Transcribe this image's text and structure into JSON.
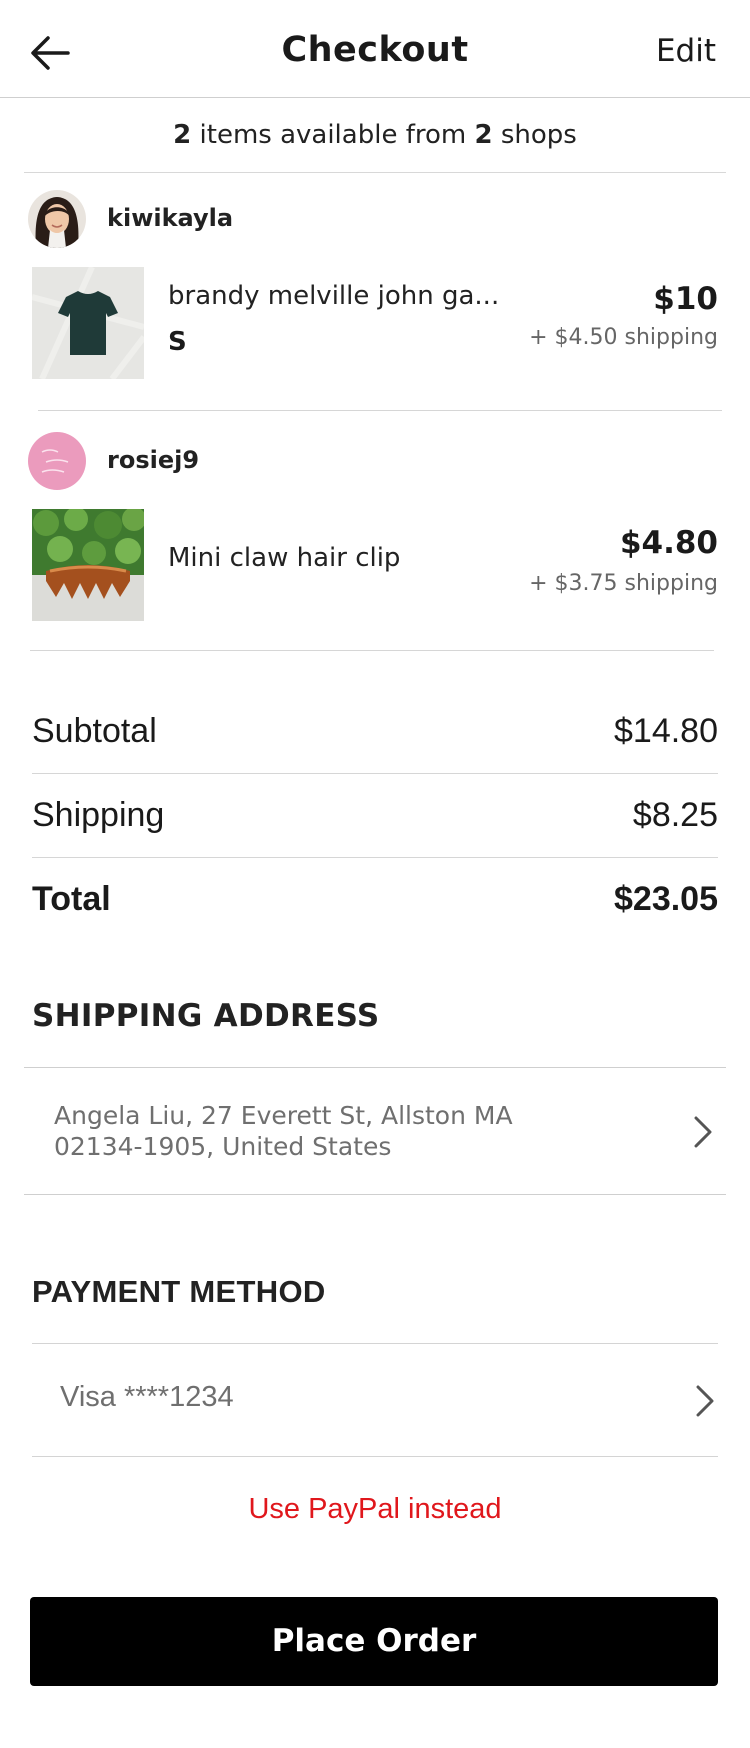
{
  "header": {
    "title": "Checkout",
    "edit_label": "Edit"
  },
  "summary": {
    "items_count": "2",
    "mid_text": "items available from",
    "shops_count": "2",
    "end_text": "shops"
  },
  "shops": [
    {
      "name": "kiwikayla",
      "item": {
        "title": "brandy melville john ga...",
        "size": "S",
        "price": "$10",
        "shipping": "+ $4.50 shipping"
      }
    },
    {
      "name": "rosiej9",
      "item": {
        "title": "Mini claw hair clip",
        "price": "$4.80",
        "shipping": "+ $3.75 shipping"
      }
    }
  ],
  "totals": {
    "subtotal_label": "Subtotal",
    "subtotal": "$14.80",
    "shipping_label": "Shipping",
    "shipping": "$8.25",
    "total_label": "Total",
    "total": "$23.05"
  },
  "shipping_address": {
    "title": "SHIPPING ADDRESS",
    "line1": "Angela Liu, 27 Everett St, Allston MA",
    "line2": "02134-1905, United States"
  },
  "payment": {
    "title": "PAYMENT METHOD",
    "card": "Visa ****1234",
    "paypal_label": "Use PayPal instead"
  },
  "actions": {
    "place_order_label": "Place Order"
  },
  "colors": {
    "accent_red": "#e0171c",
    "button_bg": "#000000"
  },
  "icons": {
    "back": "arrow-left-icon",
    "chevron": "chevron-right-icon"
  }
}
